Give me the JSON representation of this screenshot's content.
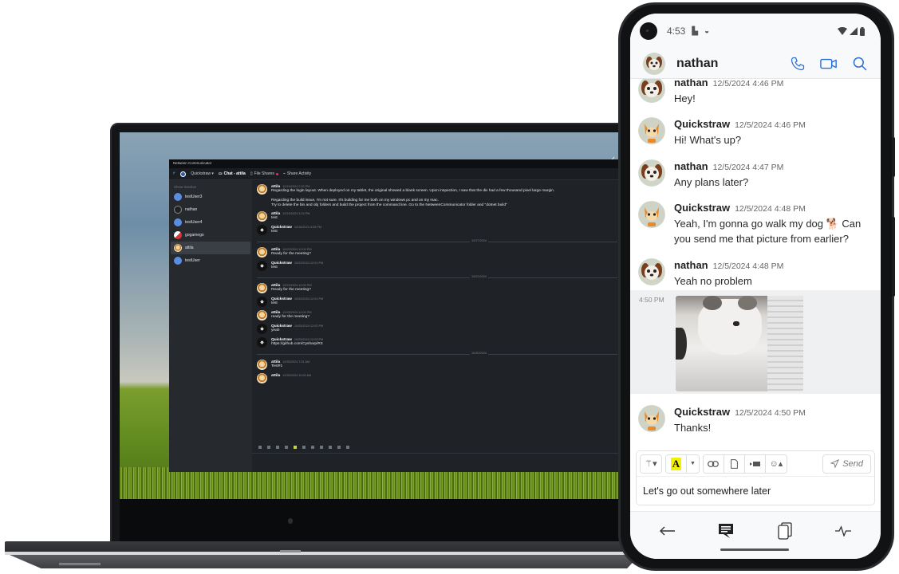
{
  "laptop": {
    "app": {
      "window_title": "Netween Communicator",
      "toolbar": {
        "user_menu": "Quickstraw ▾",
        "tabs": [
          {
            "label": "Chat - attila",
            "icon": "chat-icon",
            "active": true
          },
          {
            "label": "File Shares",
            "icon": "file-icon",
            "badge": true
          },
          {
            "label": "Share Activity",
            "icon": "activity-icon"
          }
        ]
      },
      "sidebar": {
        "section_label": "Show Inactive",
        "contacts": [
          {
            "name": "testUser3"
          },
          {
            "name": "nathan"
          },
          {
            "name": "testUser4"
          },
          {
            "name": "gogamego"
          },
          {
            "name": "attila",
            "active": true
          },
          {
            "name": "testUser"
          }
        ]
      },
      "messages": [
        {
          "author": "attila",
          "time": "10/16/2024 2:32 PM",
          "lines": [
            "Regarding the login layout. When deployed on my tablet, the original showed a blank screen. Upon inspection, I saw that the div had a few thousand pixel large margin.",
            "",
            "Regarding the build issue, I'm not sure. It's building for me both on my windows pc and on my mac.",
            "Try to delete the bin and obj folders and build the project from the command line. Go to the NetweenCommunicator folder and \"dotnet build\""
          ]
        },
        {
          "author": "attila",
          "time": "10/16/2024 3:24 PM",
          "lines": [
            "test"
          ]
        },
        {
          "author": "Quickstraw",
          "time": "10/16/2024 3:25 PM",
          "lines": [
            "test"
          ]
        },
        {
          "separator": "10/17/2024"
        },
        {
          "author": "attila",
          "time": "10/22/2024 12:00 PM",
          "lines": [
            "Ready for the meeting?"
          ]
        },
        {
          "author": "Quickstraw",
          "time": "10/22/2024 12:01 PM",
          "lines": [
            "test"
          ]
        },
        {
          "separator": "10/22/2024"
        },
        {
          "author": "attila",
          "time": "10/22/2024 12:00 PM",
          "lines": [
            "Ready for the meeting?"
          ]
        },
        {
          "author": "Quickstraw",
          "time": "10/22/2024 12:01 PM",
          "lines": [
            "test"
          ]
        },
        {
          "author": "attila",
          "time": "10/25/2024 12:00 PM",
          "lines": [
            "ready for the meeting?"
          ]
        },
        {
          "author": "Quickstraw",
          "time": "10/25/2024 12:02 PM",
          "lines": [
            "yeah"
          ]
        },
        {
          "author": "Quickstraw",
          "time": "10/25/2024 12:03 PM",
          "lines": [
            "https://github.com/Cysharp/R3"
          ]
        },
        {
          "separator": "10/30/2024"
        },
        {
          "author": "attila",
          "time": "10/30/2024 7:31 AM",
          "lines": [
            "Test#1"
          ]
        },
        {
          "author": "attila",
          "time": "10/30/2024 10:00 AM",
          "lines": [
            ""
          ]
        }
      ]
    }
  },
  "phone": {
    "status_bar": {
      "time": "4:53"
    },
    "header": {
      "contact_name": "nathan"
    },
    "messages": [
      {
        "author": "nathan",
        "time": "12/5/2024 4:46 PM",
        "text": "Hey!"
      },
      {
        "author": "Quickstraw",
        "time": "12/5/2024 4:46 PM",
        "text": "Hi! What's up?"
      },
      {
        "author": "nathan",
        "time": "12/5/2024 4:47 PM",
        "text": "Any plans later?"
      },
      {
        "author": "Quickstraw",
        "time": "12/5/2024 4:48 PM",
        "text": "Yeah, I'm gonna go walk my dog 🐕 Can you send me that picture from earlier?"
      },
      {
        "author": "nathan",
        "time": "12/5/2024 4:48 PM",
        "text": "Yeah no problem"
      },
      {
        "author": "Quickstraw",
        "time": "12/5/2024 4:50 PM",
        "text": "Thanks!"
      }
    ],
    "image_message": {
      "time": "4:50 PM",
      "alt": "cat photo"
    },
    "composer": {
      "input_value": "Let's go out somewhere later",
      "send_label": "Send",
      "highlight_label": "A"
    }
  }
}
